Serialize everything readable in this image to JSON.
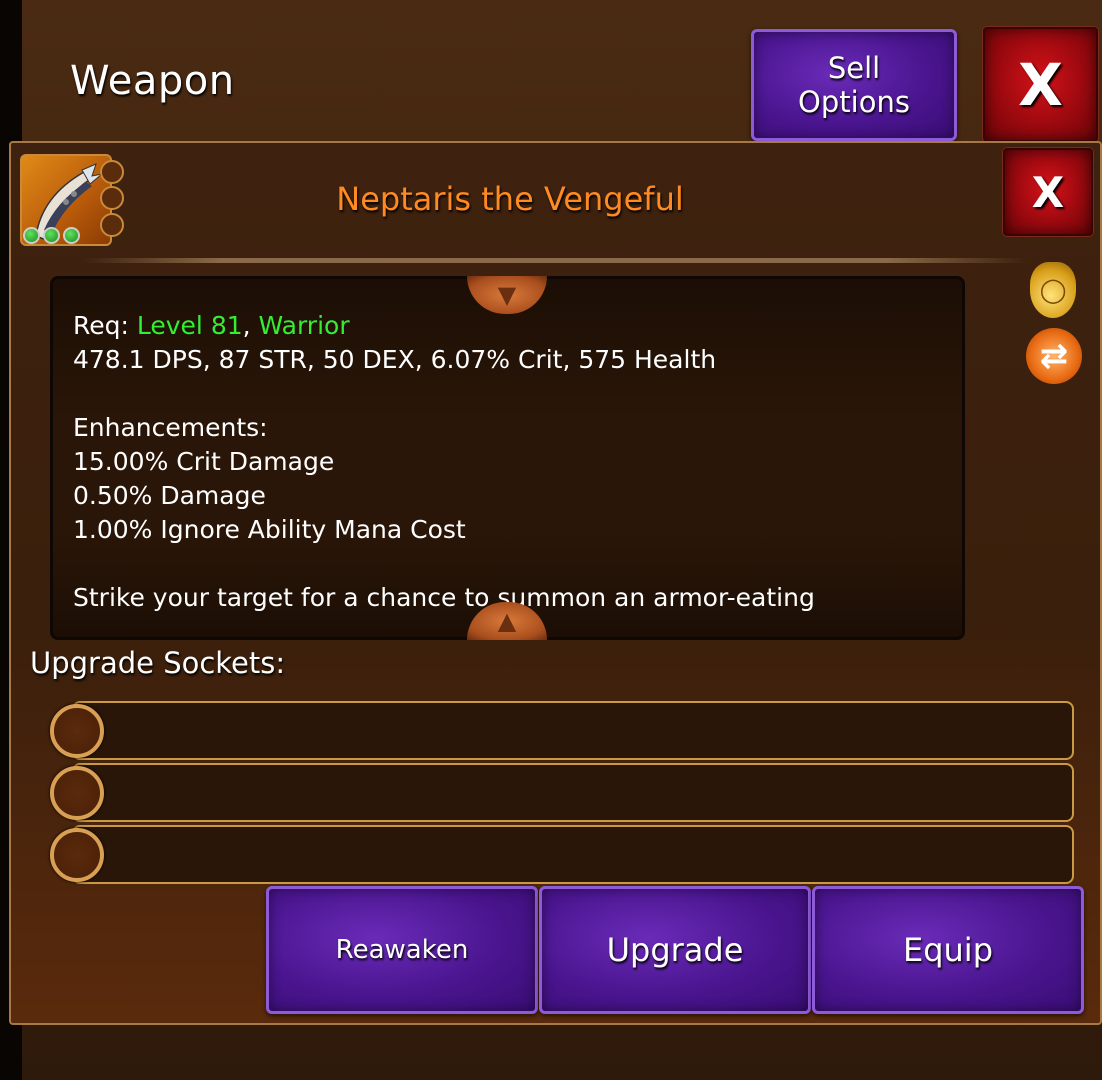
{
  "header": {
    "title": "Weapon",
    "sell_options_label": "Sell\nOptions",
    "close_label": "X"
  },
  "item": {
    "name": "Neptaris the Vengeful",
    "close_label": "X",
    "icon": "curved-blade-icon",
    "gem_count_filled": 3,
    "empty_gem_slots": 3
  },
  "description": {
    "req_prefix": "Req: ",
    "req_level": "Level 81",
    "req_sep": ", ",
    "req_class": "Warrior",
    "stats": "478.1 DPS, 87 STR, 50 DEX, 6.07% Crit, 575 Health",
    "enhancements_title": "Enhancements:",
    "enhancements": [
      "15.00% Crit Damage",
      "0.50% Damage",
      "1.00% Ignore Ability Mana Cost"
    ],
    "ability_text": "Strike your target for a chance to summon an armor-eating"
  },
  "side_icons": [
    "gold-bag-icon",
    "refresh-icon"
  ],
  "sockets": {
    "label": "Upgrade Sockets:",
    "count": 3
  },
  "actions": {
    "reawaken": "Reawaken",
    "upgrade": "Upgrade",
    "equip": "Equip"
  },
  "colors": {
    "item_name": "#ff8a22",
    "requirement": "#33ee33",
    "button_purple": "#4a158f",
    "close_red": "#a00a10"
  }
}
